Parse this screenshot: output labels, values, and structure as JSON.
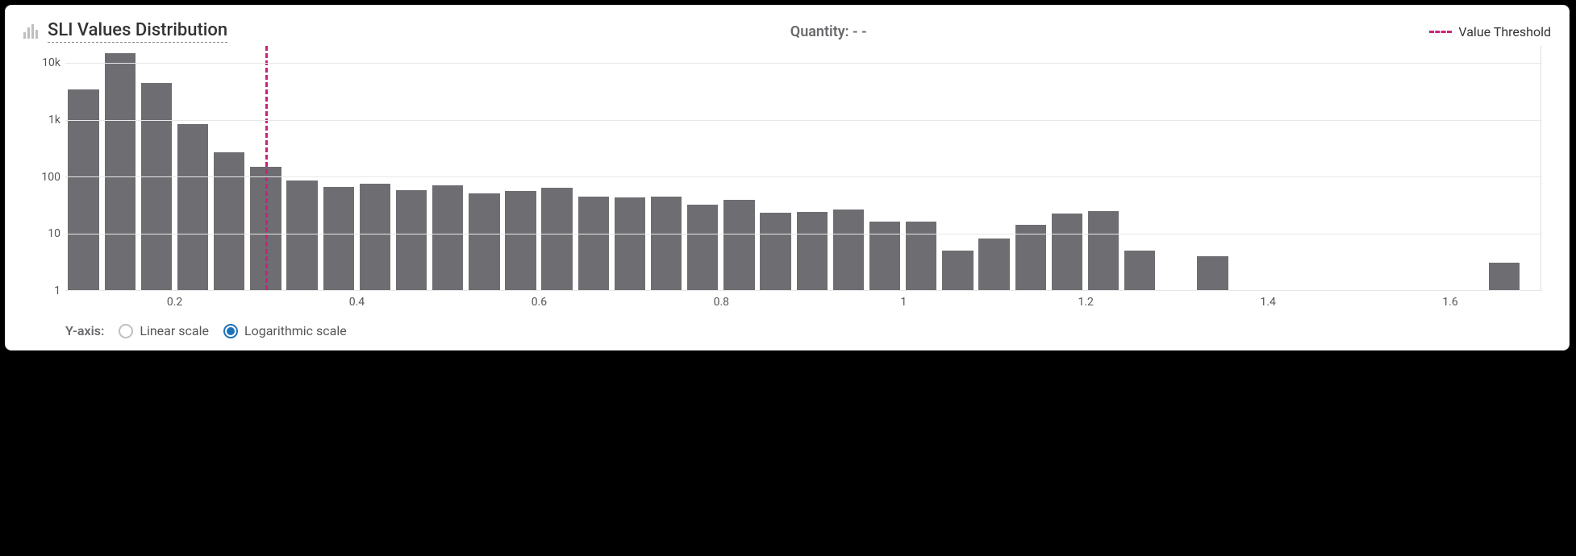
{
  "header": {
    "title": "SLI Values Distribution",
    "quantity_label": "Quantity: - -",
    "legend_label": "Value Threshold"
  },
  "controls": {
    "yaxis_label": "Y-axis:",
    "linear_label": "Linear scale",
    "log_label": "Logarithmic scale",
    "selected": "log"
  },
  "chart_data": {
    "type": "bar",
    "title": "SLI Values Distribution",
    "xlabel": "",
    "ylabel": "",
    "yscale": "log",
    "ylim": [
      1,
      20000
    ],
    "ytick_labels": [
      "1",
      "10",
      "100",
      "1k",
      "10k"
    ],
    "ytick_values": [
      1,
      10,
      100,
      1000,
      10000
    ],
    "xtick_values": [
      0.2,
      0.4,
      0.6,
      0.8,
      1.0,
      1.2,
      1.4,
      1.6
    ],
    "xtick_labels": [
      "0.2",
      "0.4",
      "0.6",
      "0.8",
      "1",
      "1.2",
      "1.4",
      "1.6"
    ],
    "xlim": [
      0.08,
      1.7
    ],
    "bin_width": 0.04,
    "threshold_x": 0.3,
    "categories": [
      0.1,
      0.14,
      0.18,
      0.22,
      0.26,
      0.3,
      0.34,
      0.38,
      0.42,
      0.46,
      0.5,
      0.54,
      0.58,
      0.62,
      0.66,
      0.7,
      0.74,
      0.78,
      0.82,
      0.86,
      0.9,
      0.94,
      0.98,
      1.02,
      1.06,
      1.1,
      1.14,
      1.18,
      1.22,
      1.26,
      1.3,
      1.34,
      1.38,
      1.42,
      1.46,
      1.5,
      1.54,
      1.58,
      1.62,
      1.66
    ],
    "values": [
      3400,
      15000,
      4500,
      830,
      270,
      150,
      85,
      65,
      75,
      58,
      70,
      50,
      55,
      63,
      44,
      43,
      44,
      32,
      39,
      23,
      24,
      26,
      16,
      16,
      5,
      8,
      14,
      22,
      25,
      5,
      null,
      4,
      1,
      null,
      1,
      1,
      null,
      1,
      1,
      3
    ]
  }
}
